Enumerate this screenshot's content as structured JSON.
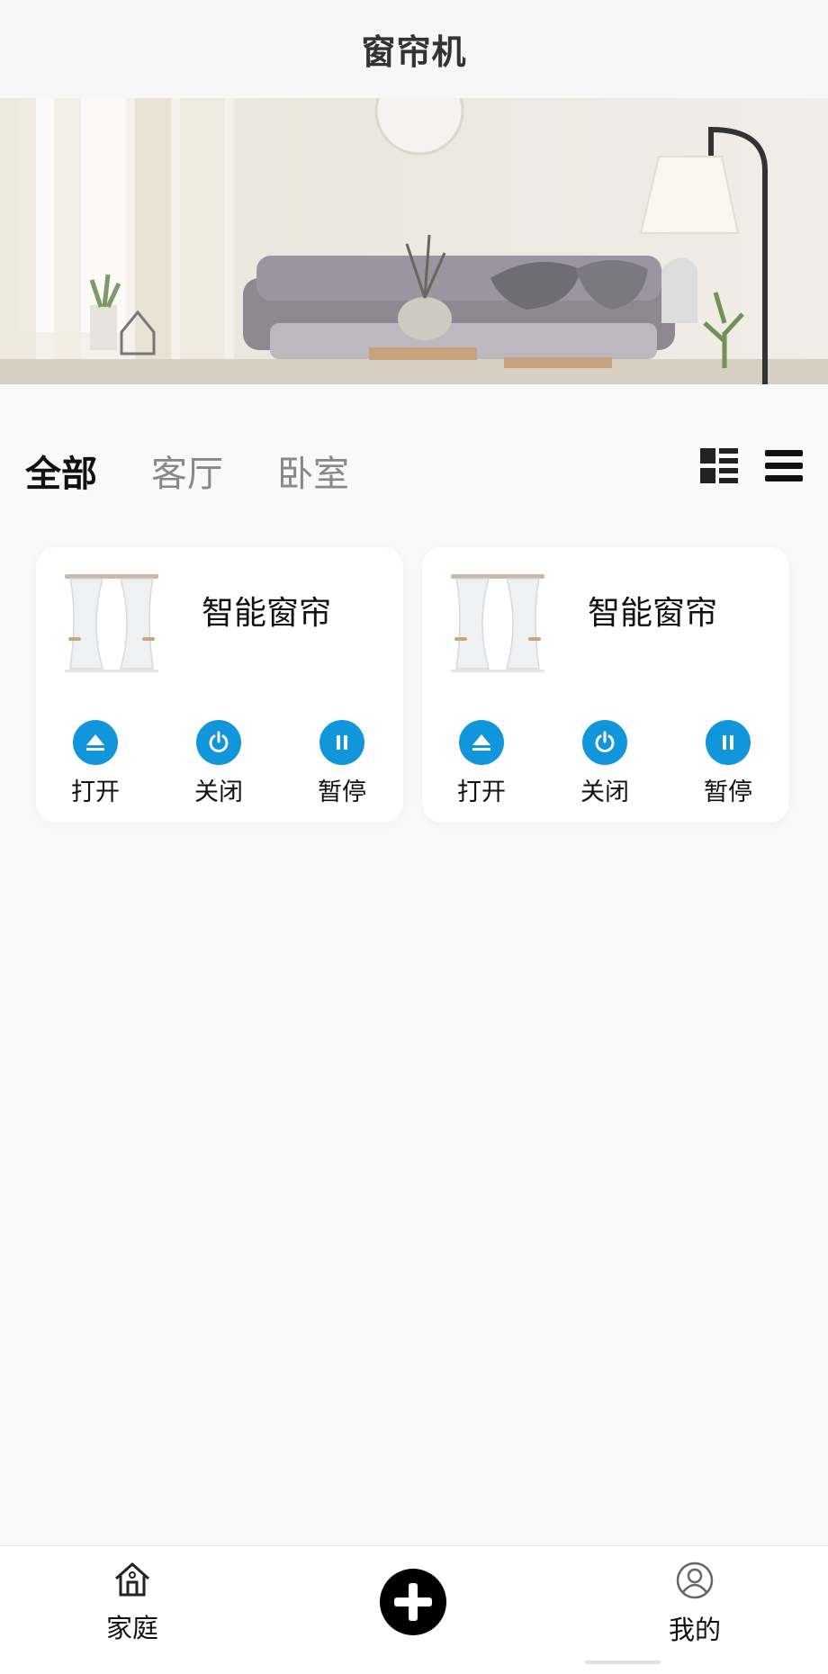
{
  "header": {
    "title": "窗帘机"
  },
  "tabs": [
    {
      "label": "全部",
      "active": true
    },
    {
      "label": "客厅",
      "active": false
    },
    {
      "label": "卧室",
      "active": false
    }
  ],
  "view_icons": [
    "grid-view-icon",
    "list-view-icon"
  ],
  "devices": [
    {
      "name": "智能窗帘",
      "controls": [
        {
          "label": "打开",
          "icon": "eject-icon"
        },
        {
          "label": "关闭",
          "icon": "power-icon"
        },
        {
          "label": "暂停",
          "icon": "pause-icon"
        }
      ]
    },
    {
      "name": "智能窗帘",
      "controls": [
        {
          "label": "打开",
          "icon": "eject-icon"
        },
        {
          "label": "关闭",
          "icon": "power-icon"
        },
        {
          "label": "暂停",
          "icon": "pause-icon"
        }
      ]
    }
  ],
  "bottom_nav": {
    "home_label": "家庭",
    "add_icon": "plus-icon",
    "profile_label": "我的"
  },
  "colors": {
    "accent": "#1296db",
    "background": "#f9f9f9",
    "card": "#ffffff"
  }
}
